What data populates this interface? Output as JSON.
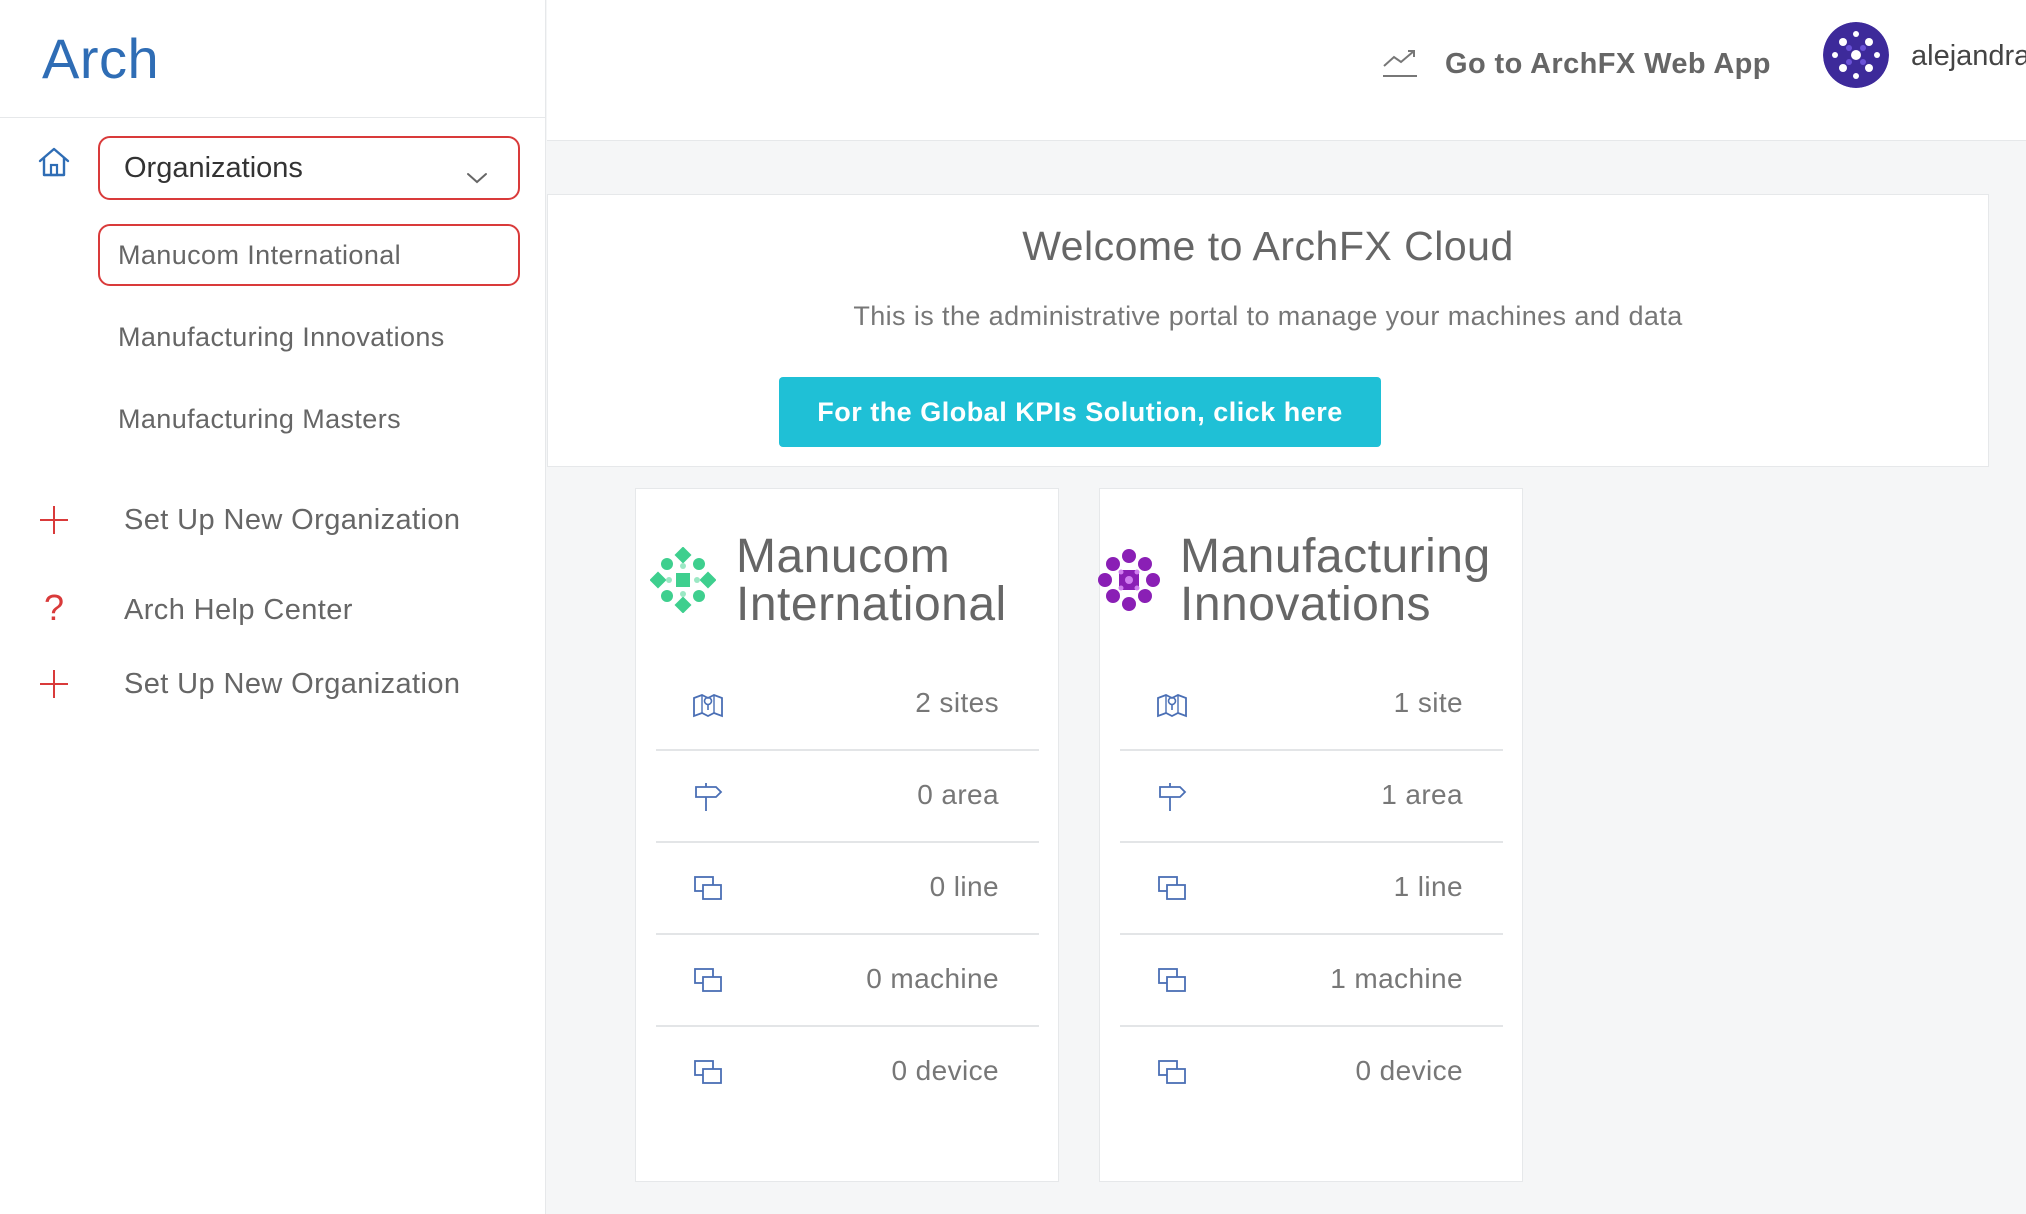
{
  "app": {
    "logo": "Arch"
  },
  "sidebar": {
    "org_selector_label": "Organizations",
    "organizations": [
      {
        "label": "Manucom International",
        "selected": true
      },
      {
        "label": "Manufacturing Innovations",
        "selected": false
      },
      {
        "label": "Manufacturing Masters",
        "selected": false
      }
    ],
    "links": [
      {
        "label": "Set Up New Organization",
        "icon": "plus-icon"
      },
      {
        "label": "Arch Help Center",
        "icon": "question-icon"
      },
      {
        "label": "Set Up New Organization",
        "icon": "plus-icon"
      }
    ],
    "icons": {
      "home": "home-icon",
      "dropdown": "chevron-down-icon"
    }
  },
  "header": {
    "webapp_link": "Go to ArchFX Web App",
    "webapp_icon": "trend-chart-icon",
    "username": "alejandra"
  },
  "welcome": {
    "title": "Welcome to ArchFX Cloud",
    "subtitle": "This is the administrative portal to manage your machines and data",
    "kpi_button": "For the Global KPIs Solution, click here"
  },
  "cards": [
    {
      "title_line1": "Manucom",
      "title_line2": "International",
      "logo_color": "#3ecf8e",
      "stats": [
        {
          "icon": "map-pin-icon",
          "value": "2 sites"
        },
        {
          "icon": "signpost-icon",
          "value": "0 area"
        },
        {
          "icon": "screens-icon",
          "value": "0 line"
        },
        {
          "icon": "screens-icon",
          "value": "0 machine"
        },
        {
          "icon": "screens-icon",
          "value": "0 device"
        }
      ]
    },
    {
      "title_line1": "Manufacturing",
      "title_line2": "Innovations",
      "logo_color": "#8a1fb5",
      "stats": [
        {
          "icon": "map-pin-icon",
          "value": "1 site"
        },
        {
          "icon": "signpost-icon",
          "value": "1 area"
        },
        {
          "icon": "screens-icon",
          "value": "1 line"
        },
        {
          "icon": "screens-icon",
          "value": "1 machine"
        },
        {
          "icon": "screens-icon",
          "value": "0 device"
        }
      ]
    }
  ],
  "colors": {
    "brand": "#2f6db5",
    "accent_button": "#1fc0d6",
    "highlight_border": "#d93a3a",
    "plus_icon": "#d93a3a"
  }
}
